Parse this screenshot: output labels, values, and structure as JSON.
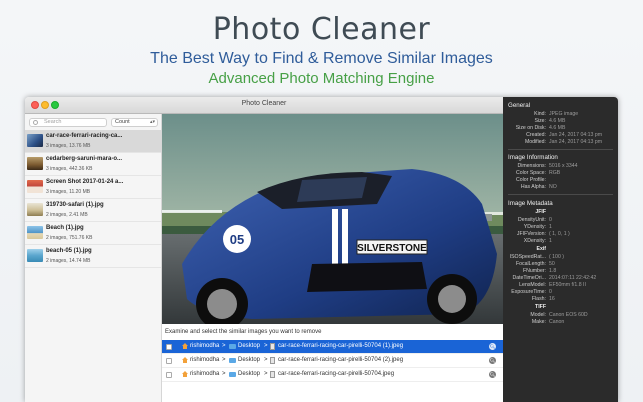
{
  "hero": {
    "title": "Photo Cleaner",
    "subtitle": "The Best Way to Find & Remove Similar Images",
    "tagline": "Advanced Photo Matching Engine",
    "subtitle_color": "#2f5c9a",
    "tagline_color": "#47a046"
  },
  "window": {
    "title": "Photo Cleaner"
  },
  "sidebar": {
    "search_placeholder": "Search",
    "sort_value": "Count",
    "groups": [
      {
        "name": "car-race-ferrari-racing-ca...",
        "meta": "3 images, 13.76 MB",
        "selected": true,
        "thumb_color": "#4a6fa5"
      },
      {
        "name": "cedarberg-saruni-mara-o...",
        "meta": "3 images, 442.36 KB",
        "selected": false,
        "thumb_color": "#8a6a3f"
      },
      {
        "name": "Screen Shot 2017-01-24 a...",
        "meta": "3 images, 11.20 MB",
        "selected": false,
        "thumb_color": "#c0453a"
      },
      {
        "name": "319730-safari (1).jpg",
        "meta": "2 images, 2.41 MB",
        "selected": false,
        "thumb_color": "#d9d2b6"
      },
      {
        "name": "Beach (1).jpg",
        "meta": "2 images, 751.76 KB",
        "selected": false,
        "thumb_color": "#5f9ec9"
      },
      {
        "name": "beach-05 (1).jpg",
        "meta": "2 images, 14.74 MB",
        "selected": false,
        "thumb_color": "#6aa9c8"
      }
    ]
  },
  "main": {
    "instructions": "Examine and select the similar images you want to remove",
    "files": [
      {
        "user": "rishimodha",
        "folder": "Desktop",
        "name": "car-race-ferrari-racing-car-pirelli-50704 (1).jpeg",
        "selected": true
      },
      {
        "user": "rishimodha",
        "folder": "Desktop",
        "name": "car-race-ferrari-racing-car-pirelli-50704 (2).jpeg",
        "selected": false
      },
      {
        "user": "rishimodha",
        "folder": "Desktop",
        "name": "car-race-ferrari-racing-car-pirelli-50704.jpeg",
        "selected": false
      }
    ],
    "separator": ">"
  },
  "photo": {
    "banner_text": "SILVERSTONE",
    "car_number": "05"
  },
  "inspector": {
    "general_title": "General",
    "general": [
      {
        "k": "Kind:",
        "v": "JPEG image"
      },
      {
        "k": "Size:",
        "v": "4.6 MB"
      },
      {
        "k": "Size on Disk:",
        "v": "4.6 MB"
      },
      {
        "k": "Created:",
        "v": "Jan 24, 2017 04:13 pm"
      },
      {
        "k": "Modified:",
        "v": "Jan 24, 2017 04:13 pm"
      }
    ],
    "info_title": "Image Information",
    "info": [
      {
        "k": "Dimensions:",
        "v": "5016 x 3344"
      },
      {
        "k": "Color Space:",
        "v": "RGB"
      },
      {
        "k": "Color Profile:",
        "v": ""
      },
      {
        "k": "Has Alpha:",
        "v": "NO"
      }
    ],
    "meta_title": "Image Metadata",
    "jfif_title": "JFIF",
    "jfif": [
      {
        "k": "DensityUnit:",
        "v": "0"
      },
      {
        "k": "YDensity:",
        "v": "1"
      },
      {
        "k": "JFIFVersion:",
        "v": "( 1, 0, 1 )"
      },
      {
        "k": "XDensity:",
        "v": "1"
      }
    ],
    "exif_title": "Exif",
    "exif": [
      {
        "k": "ISOSpeedRat...",
        "v": "( 100 )"
      },
      {
        "k": "FocalLength:",
        "v": "50"
      },
      {
        "k": "FNumber:",
        "v": "1.8"
      },
      {
        "k": "DateTimeOri...",
        "v": "2014:07:11 22:42:42"
      },
      {
        "k": "LensModel:",
        "v": "EF50mm f/1.8 II"
      },
      {
        "k": "ExposureTime:",
        "v": "0"
      },
      {
        "k": "Flash:",
        "v": "16"
      }
    ],
    "tiff_title": "TIFF",
    "tiff": [
      {
        "k": "Model:",
        "v": "Canon EOS 60D"
      },
      {
        "k": "Make:",
        "v": "Canon"
      }
    ]
  }
}
